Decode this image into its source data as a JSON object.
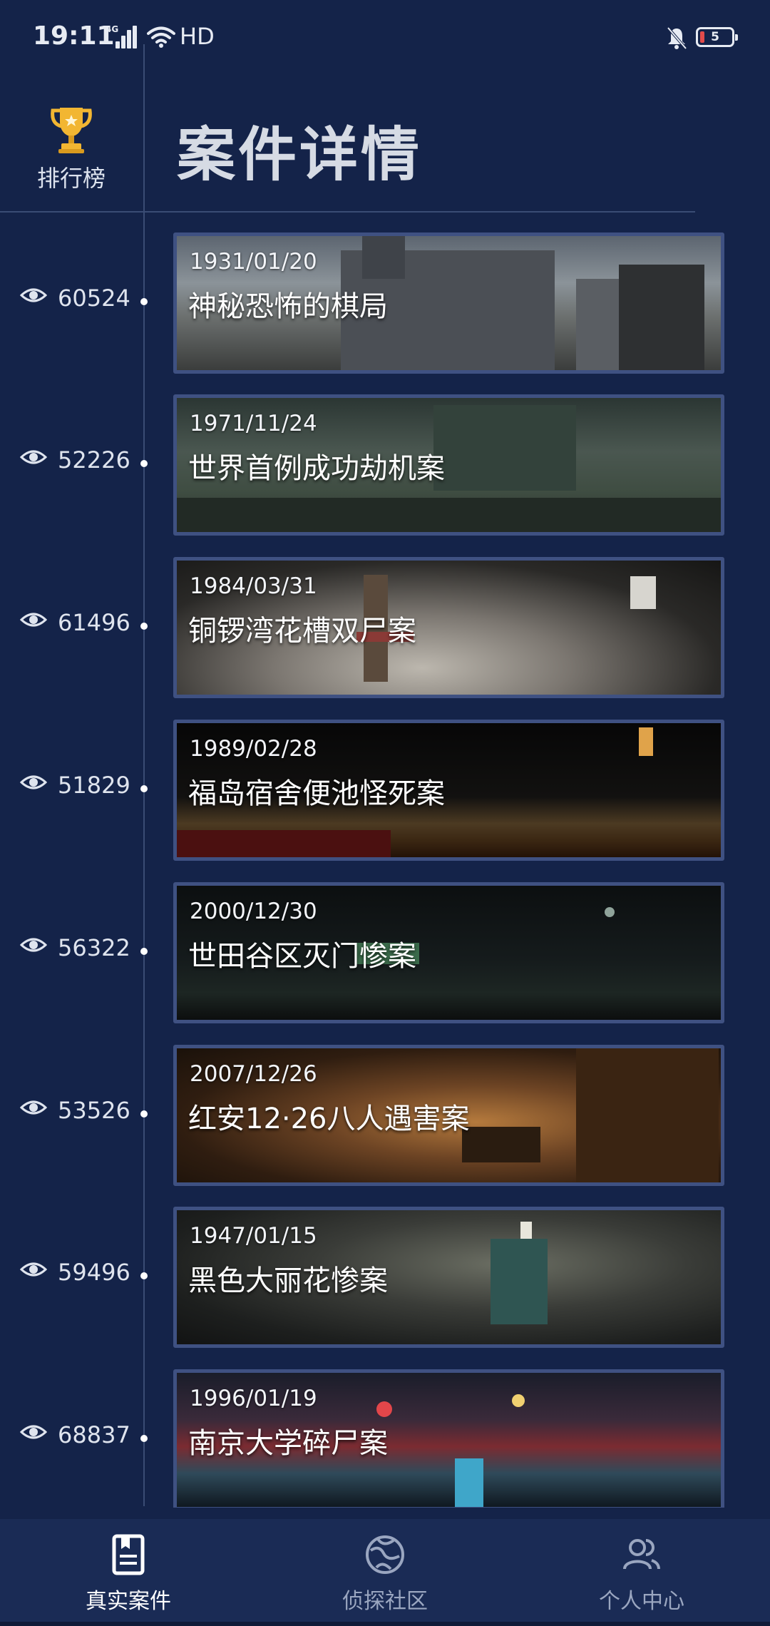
{
  "status_bar": {
    "time": "19:11",
    "network": "4G",
    "quality": "HD",
    "battery_level": "5",
    "icons": [
      "signal-icon",
      "wifi-icon",
      "mute-icon",
      "battery-icon"
    ]
  },
  "header": {
    "leaderboard_label": "排行榜",
    "leaderboard_icon": "trophy-icon",
    "title": "案件详情"
  },
  "cases": [
    {
      "views": "60524",
      "date": "1931/01/20",
      "title": "神秘恐怖的棋局"
    },
    {
      "views": "52226",
      "date": "1971/11/24",
      "title": "世界首例成功劫机案"
    },
    {
      "views": "61496",
      "date": "1984/03/31",
      "title": "铜锣湾花槽双尸案"
    },
    {
      "views": "51829",
      "date": "1989/02/28",
      "title": "福岛宿舍便池怪死案"
    },
    {
      "views": "56322",
      "date": "2000/12/30",
      "title": "世田谷区灭门惨案"
    },
    {
      "views": "53526",
      "date": "2007/12/26",
      "title": "红安12·26八人遇害案"
    },
    {
      "views": "59496",
      "date": "1947/01/15",
      "title": "黑色大丽花惨案"
    },
    {
      "views": "68837",
      "date": "1996/01/19",
      "title": "南京大学碎尸案"
    }
  ],
  "bottom_nav": [
    {
      "label": "真实案件",
      "icon": "document-icon",
      "active": true
    },
    {
      "label": "侦探社区",
      "icon": "community-icon",
      "active": false
    },
    {
      "label": "个人中心",
      "icon": "profile-icon",
      "active": false
    }
  ],
  "colors": {
    "background": "#142349",
    "card_border": "#3f5182",
    "nav_background": "#1a2b55",
    "trophy": "#f2b632"
  }
}
